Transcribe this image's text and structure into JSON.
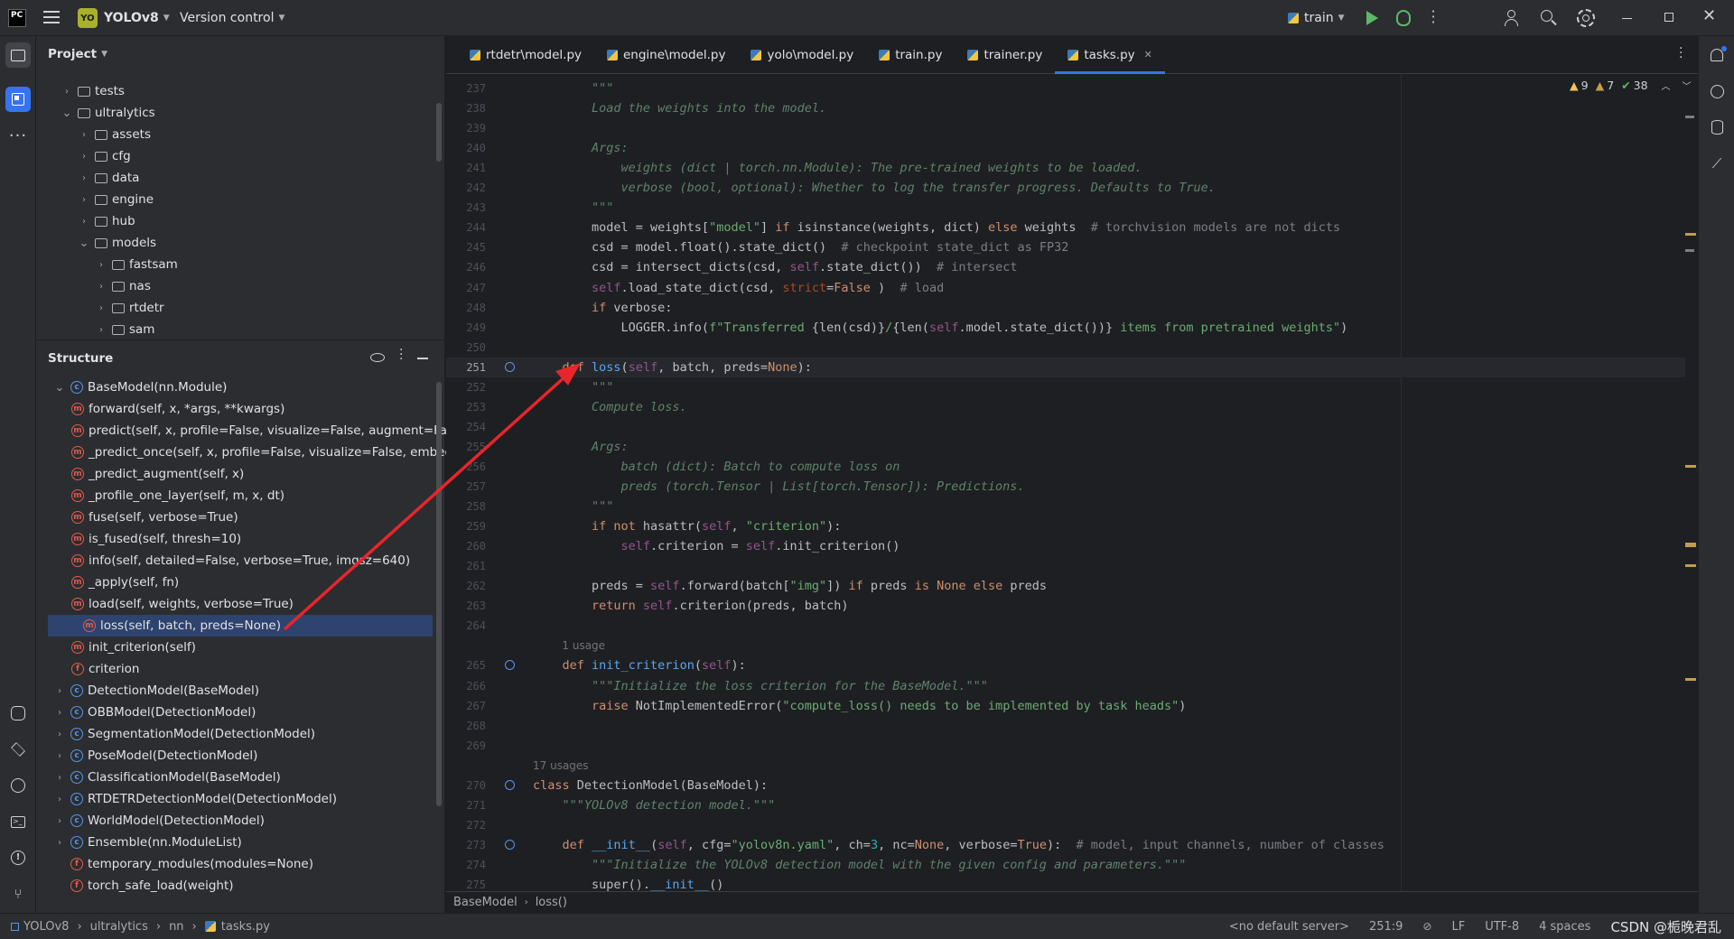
{
  "titlebar": {
    "project_badge": "YO",
    "project": "YOLOv8",
    "vcs": "Version control",
    "run_config": "train"
  },
  "tabs": [
    "rtdetr\\model.py",
    "engine\\model.py",
    "yolo\\model.py",
    "train.py",
    "trainer.py",
    "tasks.py"
  ],
  "inspections": {
    "warnings": "9",
    "weak": "7",
    "ok": "38"
  },
  "project_panel": {
    "title": "Project",
    "items": [
      {
        "label": "tests",
        "depth": 1,
        "open": false
      },
      {
        "label": "ultralytics",
        "depth": 1,
        "open": true
      },
      {
        "label": "assets",
        "depth": 2,
        "open": false
      },
      {
        "label": "cfg",
        "depth": 2,
        "open": false
      },
      {
        "label": "data",
        "depth": 2,
        "open": false
      },
      {
        "label": "engine",
        "depth": 2,
        "open": false
      },
      {
        "label": "hub",
        "depth": 2,
        "open": false
      },
      {
        "label": "models",
        "depth": 2,
        "open": true
      },
      {
        "label": "fastsam",
        "depth": 3,
        "open": false
      },
      {
        "label": "nas",
        "depth": 3,
        "open": false
      },
      {
        "label": "rtdetr",
        "depth": 3,
        "open": false
      },
      {
        "label": "sam",
        "depth": 3,
        "open": false
      }
    ]
  },
  "structure_panel": {
    "title": "Structure",
    "items": [
      {
        "label": "BaseModel(nn.Module)",
        "kind": "c",
        "depth": 0,
        "arrow": "open"
      },
      {
        "label": "forward(self, x, *args, **kwargs)",
        "kind": "m",
        "depth": 1
      },
      {
        "label": "predict(self, x, profile=False, visualize=False, augment=False",
        "kind": "m",
        "depth": 1
      },
      {
        "label": "_predict_once(self, x, profile=False, visualize=False, embed=",
        "kind": "m",
        "depth": 1
      },
      {
        "label": "_predict_augment(self, x)",
        "kind": "m",
        "depth": 1
      },
      {
        "label": "_profile_one_layer(self, m, x, dt)",
        "kind": "m",
        "depth": 1
      },
      {
        "label": "fuse(self, verbose=True)",
        "kind": "m",
        "depth": 1
      },
      {
        "label": "is_fused(self, thresh=10)",
        "kind": "m",
        "depth": 1
      },
      {
        "label": "info(self, detailed=False, verbose=True, imgsz=640)",
        "kind": "m",
        "depth": 1
      },
      {
        "label": "_apply(self, fn)",
        "kind": "m",
        "depth": 1
      },
      {
        "label": "load(self, weights, verbose=True)",
        "kind": "m",
        "depth": 1
      },
      {
        "label": "loss(self, batch, preds=None)",
        "kind": "m",
        "depth": 1,
        "selected": true
      },
      {
        "label": "init_criterion(self)",
        "kind": "m",
        "depth": 1
      },
      {
        "label": "criterion",
        "kind": "f",
        "depth": 1
      },
      {
        "label": "DetectionModel(BaseModel)",
        "kind": "c",
        "depth": 0,
        "arrow": "closed"
      },
      {
        "label": "OBBModel(DetectionModel)",
        "kind": "c",
        "depth": 0,
        "arrow": "closed"
      },
      {
        "label": "SegmentationModel(DetectionModel)",
        "kind": "c",
        "depth": 0,
        "arrow": "closed"
      },
      {
        "label": "PoseModel(DetectionModel)",
        "kind": "c",
        "depth": 0,
        "arrow": "closed"
      },
      {
        "label": "ClassificationModel(BaseModel)",
        "kind": "c",
        "depth": 0,
        "arrow": "closed"
      },
      {
        "label": "RTDETRDetectionModel(DetectionModel)",
        "kind": "c",
        "depth": 0,
        "arrow": "closed"
      },
      {
        "label": "WorldModel(DetectionModel)",
        "kind": "c",
        "depth": 0,
        "arrow": "closed"
      },
      {
        "label": "Ensemble(nn.ModuleList)",
        "kind": "c",
        "depth": 0,
        "arrow": "closed"
      },
      {
        "label": "temporary_modules(modules=None)",
        "kind": "f",
        "depth": 0
      },
      {
        "label": "torch_safe_load(weight)",
        "kind": "f",
        "depth": 0
      }
    ]
  },
  "code": [
    {
      "n": "237",
      "t": [
        [
          "doc",
          "        \"\"\""
        ]
      ]
    },
    {
      "n": "238",
      "t": [
        [
          "doc",
          "        Load the weights into the model."
        ]
      ]
    },
    {
      "n": "239",
      "t": []
    },
    {
      "n": "240",
      "t": [
        [
          "doc",
          "        Args:"
        ]
      ]
    },
    {
      "n": "241",
      "t": [
        [
          "doc",
          "            weights (dict | torch.nn.Module): The pre-trained weights to be loaded."
        ]
      ]
    },
    {
      "n": "242",
      "t": [
        [
          "doc",
          "            verbose (bool, optional): Whether to log the transfer progress. Defaults to True."
        ]
      ]
    },
    {
      "n": "243",
      "t": [
        [
          "doc",
          "        \"\"\""
        ]
      ]
    },
    {
      "n": "244",
      "t": [
        [
          "",
          "        model = weights["
        ],
        [
          "str",
          "\"model\""
        ],
        [
          "",
          "] "
        ],
        [
          "kw",
          "if"
        ],
        [
          "",
          " isinstance(weights, dict) "
        ],
        [
          "kw",
          "else"
        ],
        [
          "",
          " weights  "
        ],
        [
          "cmt",
          "# torchvision models are not dicts"
        ]
      ]
    },
    {
      "n": "245",
      "t": [
        [
          "",
          "        csd = model.float().state_dict()  "
        ],
        [
          "cmt",
          "# checkpoint state_dict as FP32"
        ]
      ]
    },
    {
      "n": "246",
      "t": [
        [
          "",
          "        csd = intersect_dicts(csd, "
        ],
        [
          "slf",
          "self"
        ],
        [
          "",
          ".state_dict())  "
        ],
        [
          "cmt",
          "# intersect"
        ]
      ]
    },
    {
      "n": "247",
      "t": [
        [
          "slf",
          "        self"
        ],
        [
          "",
          ".load_state_dict(csd, "
        ],
        [
          "prm",
          "strict"
        ],
        [
          "",
          "="
        ],
        [
          "kw",
          "False"
        ],
        [
          "",
          " )  "
        ],
        [
          "cmt",
          "# load"
        ]
      ]
    },
    {
      "n": "248",
      "t": [
        [
          "kw",
          "        if"
        ],
        [
          "",
          " verbose:"
        ]
      ]
    },
    {
      "n": "249",
      "t": [
        [
          "",
          "            LOGGER.info("
        ],
        [
          "str",
          "f\"Transferred "
        ],
        [
          "",
          "{len(csd)}"
        ],
        [
          "str",
          "/"
        ],
        [
          "",
          "{len("
        ],
        [
          "slf",
          "self"
        ],
        [
          "",
          ".model.state_dict())}"
        ],
        [
          "str",
          " items from pretrained weights\""
        ],
        [
          "",
          ")"
        ]
      ]
    },
    {
      "n": "250",
      "t": []
    },
    {
      "n": "251",
      "t": [
        [
          "kw",
          "    def "
        ],
        [
          "fn",
          "loss"
        ],
        [
          "",
          "("
        ],
        [
          "slf",
          "self"
        ],
        [
          "",
          ", batch, preds="
        ],
        [
          "kw",
          "None"
        ],
        [
          "",
          "):"
        ]
      ],
      "cur": true,
      "g": true
    },
    {
      "n": "252",
      "t": [
        [
          "doc",
          "        \"\"\""
        ]
      ]
    },
    {
      "n": "253",
      "t": [
        [
          "doc",
          "        Compute loss."
        ]
      ]
    },
    {
      "n": "254",
      "t": []
    },
    {
      "n": "255",
      "t": [
        [
          "doc",
          "        Args:"
        ]
      ]
    },
    {
      "n": "256",
      "t": [
        [
          "doc",
          "            batch (dict): Batch to compute loss on"
        ]
      ]
    },
    {
      "n": "257",
      "t": [
        [
          "doc",
          "            preds (torch.Tensor | List[torch.Tensor]): Predictions."
        ]
      ]
    },
    {
      "n": "258",
      "t": [
        [
          "doc",
          "        \"\"\""
        ]
      ]
    },
    {
      "n": "259",
      "t": [
        [
          "kw",
          "        if not"
        ],
        [
          "",
          " hasattr("
        ],
        [
          "slf",
          "self"
        ],
        [
          "",
          ", "
        ],
        [
          "str",
          "\"criterion\""
        ],
        [
          "",
          "):"
        ]
      ]
    },
    {
      "n": "260",
      "t": [
        [
          "slf",
          "            self"
        ],
        [
          "",
          ".criterion = "
        ],
        [
          "slf",
          "self"
        ],
        [
          "",
          ".init_criterion()"
        ]
      ]
    },
    {
      "n": "261",
      "t": []
    },
    {
      "n": "262",
      "t": [
        [
          "",
          "        preds = "
        ],
        [
          "slf",
          "self"
        ],
        [
          "",
          ".forward(batch["
        ],
        [
          "str",
          "\"img\""
        ],
        [
          "",
          "]) "
        ],
        [
          "kw",
          "if"
        ],
        [
          "",
          " preds "
        ],
        [
          "kw",
          "is None else"
        ],
        [
          "",
          " preds"
        ]
      ]
    },
    {
      "n": "263",
      "t": [
        [
          "kw",
          "        return "
        ],
        [
          "slf",
          "self"
        ],
        [
          "",
          ".criterion(preds, batch)"
        ]
      ]
    },
    {
      "n": "264",
      "t": []
    },
    {
      "n": "",
      "t": [],
      "hint": "1 usage",
      "hx": "    "
    },
    {
      "n": "265",
      "t": [
        [
          "kw",
          "    def "
        ],
        [
          "fn",
          "init_criterion"
        ],
        [
          "",
          "("
        ],
        [
          "slf",
          "self"
        ],
        [
          "",
          "):"
        ]
      ],
      "g": true
    },
    {
      "n": "266",
      "t": [
        [
          "doc",
          "        \"\"\"Initialize the loss criterion for the BaseModel.\"\"\""
        ]
      ]
    },
    {
      "n": "267",
      "t": [
        [
          "kw",
          "        raise"
        ],
        [
          "",
          " NotImplementedError("
        ],
        [
          "str",
          "\"compute_loss() needs to be implemented by task heads\""
        ],
        [
          "",
          ")"
        ]
      ]
    },
    {
      "n": "268",
      "t": []
    },
    {
      "n": "269",
      "t": []
    },
    {
      "n": "",
      "t": [],
      "hint": "17 usages",
      "hx": ""
    },
    {
      "n": "270",
      "t": [
        [
          "kw",
          "class "
        ],
        [
          "",
          "DetectionModel(BaseModel):"
        ]
      ],
      "g": true
    },
    {
      "n": "271",
      "t": [
        [
          "doc",
          "    \"\"\"YOLOv8 detection model.\"\"\""
        ]
      ]
    },
    {
      "n": "272",
      "t": []
    },
    {
      "n": "273",
      "t": [
        [
          "kw",
          "    def "
        ],
        [
          "fn",
          "__init__"
        ],
        [
          "",
          "("
        ],
        [
          "slf",
          "self"
        ],
        [
          "",
          ", cfg="
        ],
        [
          "str",
          "\"yolov8n.yaml\""
        ],
        [
          "",
          ", ch="
        ],
        [
          "num",
          "3"
        ],
        [
          "",
          ", nc="
        ],
        [
          "kw",
          "None"
        ],
        [
          "",
          ", verbose="
        ],
        [
          "kw",
          "True"
        ],
        [
          "",
          "):  "
        ],
        [
          "cmt",
          "# model, input channels, number of classes"
        ]
      ],
      "g": true
    },
    {
      "n": "274",
      "t": [
        [
          "doc",
          "        \"\"\"Initialize the YOLOv8 detection model with the given config and parameters.\"\"\""
        ]
      ]
    },
    {
      "n": "275",
      "t": [
        [
          "",
          "        super()."
        ],
        [
          "fn",
          "__init__"
        ],
        [
          "",
          "()"
        ]
      ]
    }
  ],
  "breadcrumb": {
    "a": "BaseModel",
    "b": "loss()"
  },
  "status": {
    "path": [
      "YOLOv8",
      "ultralytics",
      "nn",
      "tasks.py"
    ],
    "server": "<no default server>",
    "pos": "251:9",
    "eol": "LF",
    "enc": "UTF-8",
    "indent": "4 spaces",
    "watermark": "CSDN @栀晚君乱"
  }
}
